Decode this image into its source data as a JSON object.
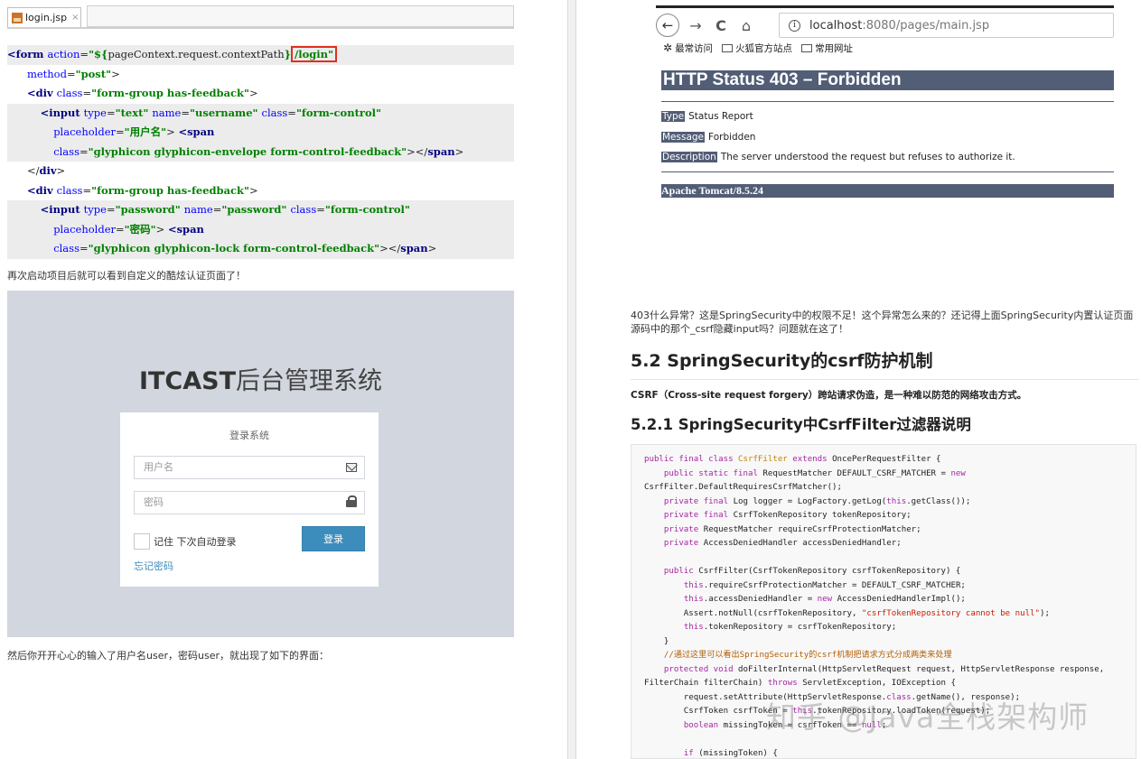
{
  "left": {
    "tab": {
      "filename": "login.jsp",
      "close": "×"
    },
    "code_lines": [
      {
        "indent": "",
        "parts": [
          [
            "tag",
            "<form "
          ],
          [
            "attr",
            "action"
          ],
          [
            "plain",
            "="
          ],
          [
            "val",
            "\"${"
          ],
          [
            "plain",
            "pageContext.request.contextPath"
          ],
          [
            "val",
            "}"
          ],
          [
            "box",
            "/login\""
          ]
        ],
        "hl": true
      },
      {
        "indent": "      ",
        "parts": [
          [
            "attr",
            "method"
          ],
          [
            "plain",
            "="
          ],
          [
            "val",
            "\"post\""
          ],
          [
            "plain",
            ">"
          ]
        ],
        "hl": false
      },
      {
        "indent": "      ",
        "parts": [
          [
            "tag",
            "<div "
          ],
          [
            "attr",
            "class"
          ],
          [
            "plain",
            "="
          ],
          [
            "val",
            "\"form-group has-feedback\""
          ],
          [
            "plain",
            ">"
          ]
        ],
        "hl": false
      },
      {
        "indent": "          ",
        "parts": [
          [
            "tag",
            "<input "
          ],
          [
            "attr",
            "type"
          ],
          [
            "plain",
            "="
          ],
          [
            "val",
            "\"text\" "
          ],
          [
            "attr",
            "name"
          ],
          [
            "plain",
            "="
          ],
          [
            "val",
            "\"username\" "
          ],
          [
            "attr",
            "class"
          ],
          [
            "plain",
            "="
          ],
          [
            "val",
            "\"form-control\""
          ]
        ],
        "hl": true
      },
      {
        "indent": "              ",
        "parts": [
          [
            "attr",
            "placeholder"
          ],
          [
            "plain",
            "="
          ],
          [
            "val",
            "\"用户名\""
          ],
          [
            "plain",
            "> "
          ],
          [
            "tag",
            "<span"
          ]
        ],
        "hl": true
      },
      {
        "indent": "              ",
        "parts": [
          [
            "attr",
            "class"
          ],
          [
            "plain",
            "="
          ],
          [
            "val",
            "\"glyphicon glyphicon-envelope form-control-feedback\""
          ],
          [
            "plain",
            "></"
          ],
          [
            "tag",
            "span"
          ],
          [
            "plain",
            ">"
          ]
        ],
        "hl": true
      },
      {
        "indent": "      ",
        "parts": [
          [
            "plain",
            "</"
          ],
          [
            "tag",
            "div"
          ],
          [
            "plain",
            ">"
          ]
        ],
        "hl": false
      },
      {
        "indent": "      ",
        "parts": [
          [
            "tag",
            "<div "
          ],
          [
            "attr",
            "class"
          ],
          [
            "plain",
            "="
          ],
          [
            "val",
            "\"form-group has-feedback\""
          ],
          [
            "plain",
            ">"
          ]
        ],
        "hl": false
      },
      {
        "indent": "          ",
        "parts": [
          [
            "tag",
            "<input "
          ],
          [
            "attr",
            "type"
          ],
          [
            "plain",
            "="
          ],
          [
            "val",
            "\"password\" "
          ],
          [
            "attr",
            "name"
          ],
          [
            "plain",
            "="
          ],
          [
            "val",
            "\"password\" "
          ],
          [
            "attr",
            "class"
          ],
          [
            "plain",
            "="
          ],
          [
            "val",
            "\"form-control\""
          ]
        ],
        "hl": true
      },
      {
        "indent": "              ",
        "parts": [
          [
            "attr",
            "placeholder"
          ],
          [
            "plain",
            "="
          ],
          [
            "val",
            "\"密码\""
          ],
          [
            "plain",
            "> "
          ],
          [
            "tag",
            "<span"
          ]
        ],
        "hl": true
      },
      {
        "indent": "              ",
        "parts": [
          [
            "attr",
            "class"
          ],
          [
            "plain",
            "="
          ],
          [
            "val",
            "\"glyphicon glyphicon-lock form-control-feedback\""
          ],
          [
            "plain",
            "></"
          ],
          [
            "tag",
            "span"
          ],
          [
            "plain",
            ">"
          ]
        ],
        "hl": true
      }
    ],
    "para1": "再次启动项目后就可以看到自定义的酷炫认证页面了！",
    "login": {
      "title_bold": "ITCAST",
      "title_rest": "后台管理系统",
      "card_title": "登录系统",
      "username_placeholder": "用户名",
      "password_placeholder": "密码",
      "remember": "记住 下次自动登录",
      "login_button": "登录",
      "forgot": "忘记密码"
    },
    "para2": "然后你开开心心的输入了用户名user，密码user，就出现了如下的界面："
  },
  "right": {
    "browser": {
      "back": "←",
      "forward": "→",
      "reload": "C",
      "home": "⌂",
      "url_host": "localhost",
      "url_rest": ":8080/pages/main.jsp",
      "bookmarks": [
        "最常访问",
        "火狐官方站点",
        "常用网址"
      ]
    },
    "tomcat": {
      "heading": "HTTP Status 403 – Forbidden",
      "rows": [
        {
          "key": "Type",
          "value": "Status Report"
        },
        {
          "key": "Message",
          "value": "Forbidden"
        },
        {
          "key": "Description",
          "value": "The server understood the request but refuses to authorize it."
        }
      ],
      "footer": "Apache Tomcat/8.5.24"
    },
    "para": "403什么异常？这是SpringSecurity中的权限不足！这个异常怎么来的？还记得上面SpringSecurity内置认证页面源码中的那个_csrf隐藏input吗？问题就在这了！",
    "h2": "5.2 SpringSecurity的csrf防护机制",
    "bold_para": "CSRF（Cross-site request forgery）跨站请求伪造，是一种难以防范的网络攻击方式。",
    "h3": "5.2.1 SpringSecurity中CsrfFilter过滤器说明",
    "code_lines": [
      [
        [
          "kw",
          "public final class "
        ],
        [
          "ty",
          "CsrfFilter "
        ],
        [
          "kw",
          "extends "
        ],
        [
          "plain",
          "OncePerRequestFilter {"
        ]
      ],
      [
        [
          "plain",
          "    "
        ],
        [
          "kw",
          "public static final "
        ],
        [
          "plain",
          "RequestMatcher DEFAULT_CSRF_MATCHER = "
        ],
        [
          "kw",
          "new"
        ]
      ],
      [
        [
          "plain",
          "CsrfFilter.DefaultRequiresCsrfMatcher();"
        ]
      ],
      [
        [
          "plain",
          "    "
        ],
        [
          "kw",
          "private final "
        ],
        [
          "plain",
          "Log logger = LogFactory.getLog("
        ],
        [
          "kw",
          "this"
        ],
        [
          "plain",
          ".getClass());"
        ]
      ],
      [
        [
          "plain",
          "    "
        ],
        [
          "kw",
          "private final "
        ],
        [
          "plain",
          "CsrfTokenRepository tokenRepository;"
        ]
      ],
      [
        [
          "plain",
          "    "
        ],
        [
          "kw",
          "private "
        ],
        [
          "plain",
          "RequestMatcher requireCsrfProtectionMatcher;"
        ]
      ],
      [
        [
          "plain",
          "    "
        ],
        [
          "kw",
          "private "
        ],
        [
          "plain",
          "AccessDeniedHandler accessDeniedHandler;"
        ]
      ],
      [
        [
          "plain",
          ""
        ]
      ],
      [
        [
          "plain",
          "    "
        ],
        [
          "kw",
          "public "
        ],
        [
          "plain",
          "CsrfFilter(CsrfTokenRepository csrfTokenRepository) {"
        ]
      ],
      [
        [
          "plain",
          "        "
        ],
        [
          "kw",
          "this"
        ],
        [
          "plain",
          ".requireCsrfProtectionMatcher = DEFAULT_CSRF_MATCHER;"
        ]
      ],
      [
        [
          "plain",
          "        "
        ],
        [
          "kw",
          "this"
        ],
        [
          "plain",
          ".accessDeniedHandler = "
        ],
        [
          "kw",
          "new "
        ],
        [
          "plain",
          "AccessDeniedHandlerImpl();"
        ]
      ],
      [
        [
          "plain",
          "        Assert.notNull(csrfTokenRepository, "
        ],
        [
          "str",
          "\"csrfTokenRepository cannot be null\""
        ],
        [
          "plain",
          ");"
        ]
      ],
      [
        [
          "plain",
          "        "
        ],
        [
          "kw",
          "this"
        ],
        [
          "plain",
          ".tokenRepository = csrfTokenRepository;"
        ]
      ],
      [
        [
          "plain",
          "    }"
        ]
      ],
      [
        [
          "plain",
          "    "
        ],
        [
          "cmz",
          "//通过这里可以看出SpringSecurity的csrf机制把请求方式分成两类来处理"
        ]
      ],
      [
        [
          "plain",
          "    "
        ],
        [
          "kw",
          "protected void "
        ],
        [
          "plain",
          "doFilterInternal(HttpServletRequest request, HttpServletResponse response,"
        ]
      ],
      [
        [
          "plain",
          "FilterChain filterChain) "
        ],
        [
          "kw",
          "throws "
        ],
        [
          "plain",
          "ServletException, IOException {"
        ]
      ],
      [
        [
          "plain",
          "        request.setAttribute(HttpServletResponse."
        ],
        [
          "kw",
          "class"
        ],
        [
          "plain",
          ".getName(), response);"
        ]
      ],
      [
        [
          "plain",
          "        CsrfToken csrfToken = "
        ],
        [
          "kw",
          "this"
        ],
        [
          "plain",
          ".tokenRepository.loadToken(request);"
        ]
      ],
      [
        [
          "plain",
          "        "
        ],
        [
          "kw",
          "boolean "
        ],
        [
          "plain",
          "missingToken = csrfToken == "
        ],
        [
          "kw",
          "null"
        ],
        [
          "plain",
          ";"
        ]
      ],
      [
        [
          "plain",
          ""
        ]
      ],
      [
        [
          "plain",
          "        "
        ],
        [
          "kw",
          "if "
        ],
        [
          "plain",
          "(missingToken) {"
        ]
      ]
    ],
    "watermark": "知乎 @Java全栈架构师"
  }
}
